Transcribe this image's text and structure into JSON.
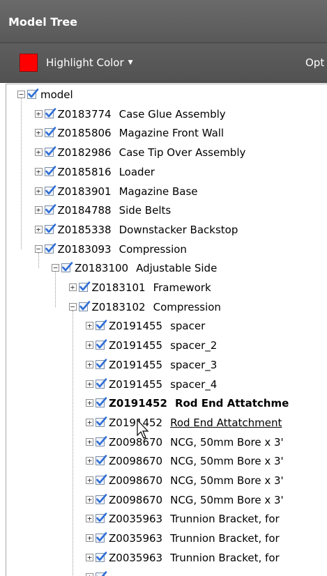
{
  "panel": {
    "title": "Model Tree"
  },
  "toolbar": {
    "highlight_label": "Highlight Color",
    "highlight_color": "#ff0000",
    "options_label": "Opt"
  },
  "tree": [
    {
      "level": 0,
      "toggle": "minus",
      "num": "",
      "name": "model"
    },
    {
      "level": 1,
      "toggle": "plus",
      "num": "Z0183774",
      "name": "Case Glue Assembly"
    },
    {
      "level": 1,
      "toggle": "plus",
      "num": "Z0185806",
      "name": "Magazine Front Wall"
    },
    {
      "level": 1,
      "toggle": "plus",
      "num": "Z0182986",
      "name": "Case Tip Over Assembly"
    },
    {
      "level": 1,
      "toggle": "plus",
      "num": "Z0185816",
      "name": "Loader"
    },
    {
      "level": 1,
      "toggle": "plus",
      "num": "Z0183901",
      "name": "Magazine Base"
    },
    {
      "level": 1,
      "toggle": "plus",
      "num": "Z0184788",
      "name": "Side Belts"
    },
    {
      "level": 1,
      "toggle": "plus",
      "num": "Z0185338",
      "name": "Downstacker Backstop"
    },
    {
      "level": 1,
      "toggle": "minus",
      "num": "Z0183093",
      "name": "Compression"
    },
    {
      "level": 2,
      "toggle": "minus",
      "num": "Z0183100",
      "name": "Adjustable Side"
    },
    {
      "level": 3,
      "toggle": "plus",
      "num": "Z0183101",
      "name": "Framework"
    },
    {
      "level": 3,
      "toggle": "minus",
      "num": "Z0183102",
      "name": "Compression"
    },
    {
      "level": 4,
      "toggle": "plus",
      "num": "Z0191455",
      "name": "spacer"
    },
    {
      "level": 4,
      "toggle": "plus",
      "num": "Z0191455",
      "name": "spacer_2"
    },
    {
      "level": 4,
      "toggle": "plus",
      "num": "Z0191455",
      "name": "spacer_3"
    },
    {
      "level": 4,
      "toggle": "plus",
      "num": "Z0191455",
      "name": "spacer_4"
    },
    {
      "level": 4,
      "toggle": "plus",
      "num": "Z0191452",
      "name": "Rod End Attatchme",
      "bold": true
    },
    {
      "level": 4,
      "toggle": "plus",
      "num": "Z0191452",
      "name": "Rod End Attatchment",
      "hover": true
    },
    {
      "level": 4,
      "toggle": "plus",
      "num": "Z0098670",
      "name": "NCG, 50mm Bore x 3'"
    },
    {
      "level": 4,
      "toggle": "plus",
      "num": "Z0098670",
      "name": "NCG, 50mm Bore x 3'"
    },
    {
      "level": 4,
      "toggle": "plus",
      "num": "Z0098670",
      "name": "NCG, 50mm Bore x 3'"
    },
    {
      "level": 4,
      "toggle": "plus",
      "num": "Z0098670",
      "name": "NCG, 50mm Bore x 3'"
    },
    {
      "level": 4,
      "toggle": "plus",
      "num": "Z0035963",
      "name": "Trunnion Bracket, for"
    },
    {
      "level": 4,
      "toggle": "plus",
      "num": "Z0035963",
      "name": "Trunnion Bracket, for"
    },
    {
      "level": 4,
      "toggle": "plus",
      "num": "Z0035963",
      "name": "Trunnion Bracket, for"
    },
    {
      "level": 4,
      "toggle": "plus",
      "num": "",
      "name": ""
    }
  ]
}
